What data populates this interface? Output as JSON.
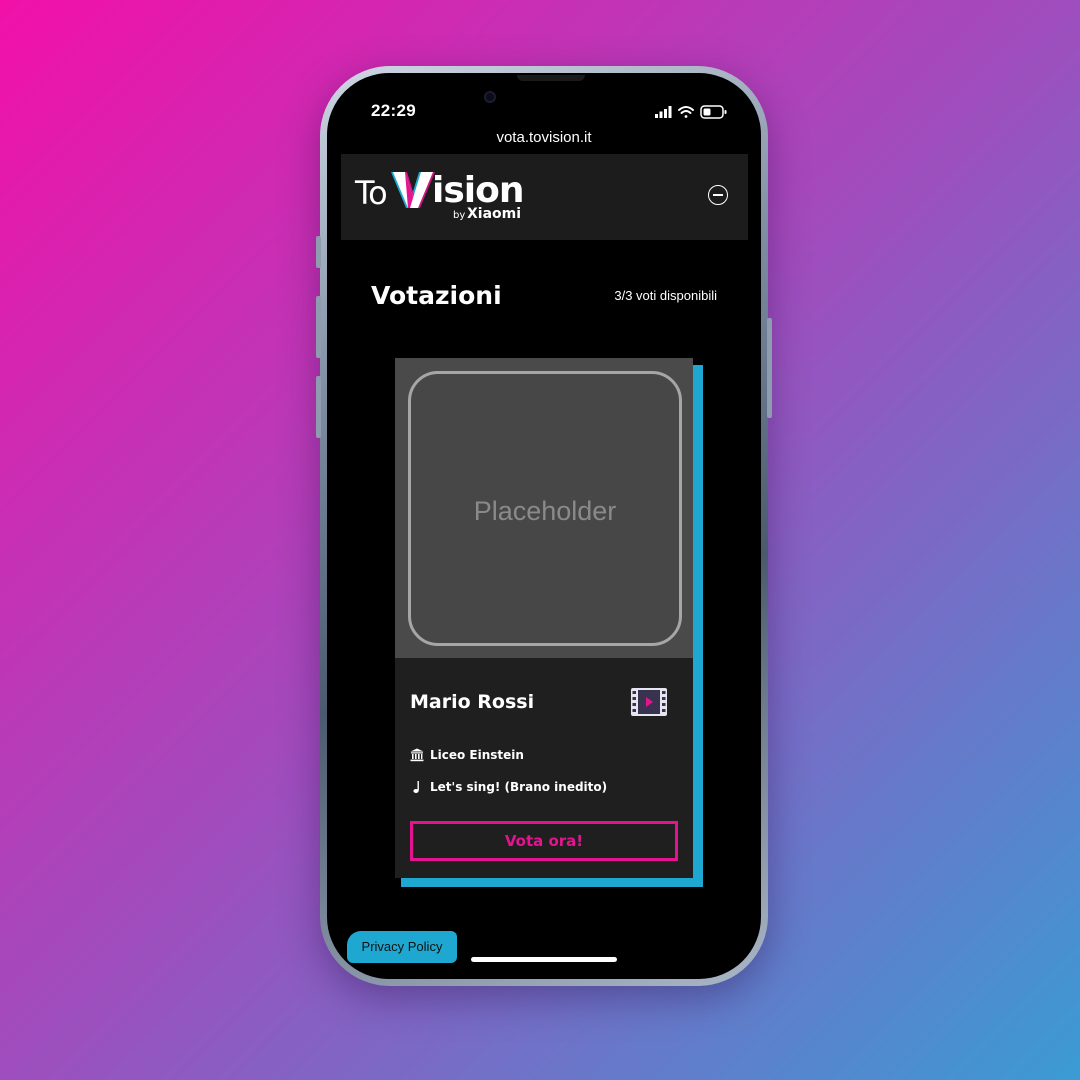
{
  "status_bar": {
    "time": "22:29",
    "signal_icon": "signal-bars-icon",
    "wifi_icon": "wifi-icon",
    "battery_icon": "battery-icon"
  },
  "browser": {
    "url": "vota.tovision.it"
  },
  "header": {
    "logo_to": "To",
    "logo_vision_rest": "ision",
    "logo_by": "by",
    "logo_xiaomi": "Xiaomi",
    "menu_icon": "minus-circle-icon"
  },
  "main": {
    "title": "Votazioni",
    "votes_available": "3/3 voti disponibili"
  },
  "card": {
    "image_placeholder": "Placeholder",
    "name": "Mario Rossi",
    "category_icon": "film-icon",
    "school_icon": "building-columns-icon",
    "school": "Liceo Einstein",
    "song_icon": "music-note-icon",
    "song": "Let's sing! (Brano inedito)",
    "vote_button": "Vota ora!"
  },
  "footer": {
    "privacy_button": "Privacy Policy"
  },
  "colors": {
    "accent_pink": "#e4138f",
    "accent_cyan": "#1ea8d1",
    "card_bg": "#1f1f1f",
    "header_bg": "#1c1c1c"
  }
}
